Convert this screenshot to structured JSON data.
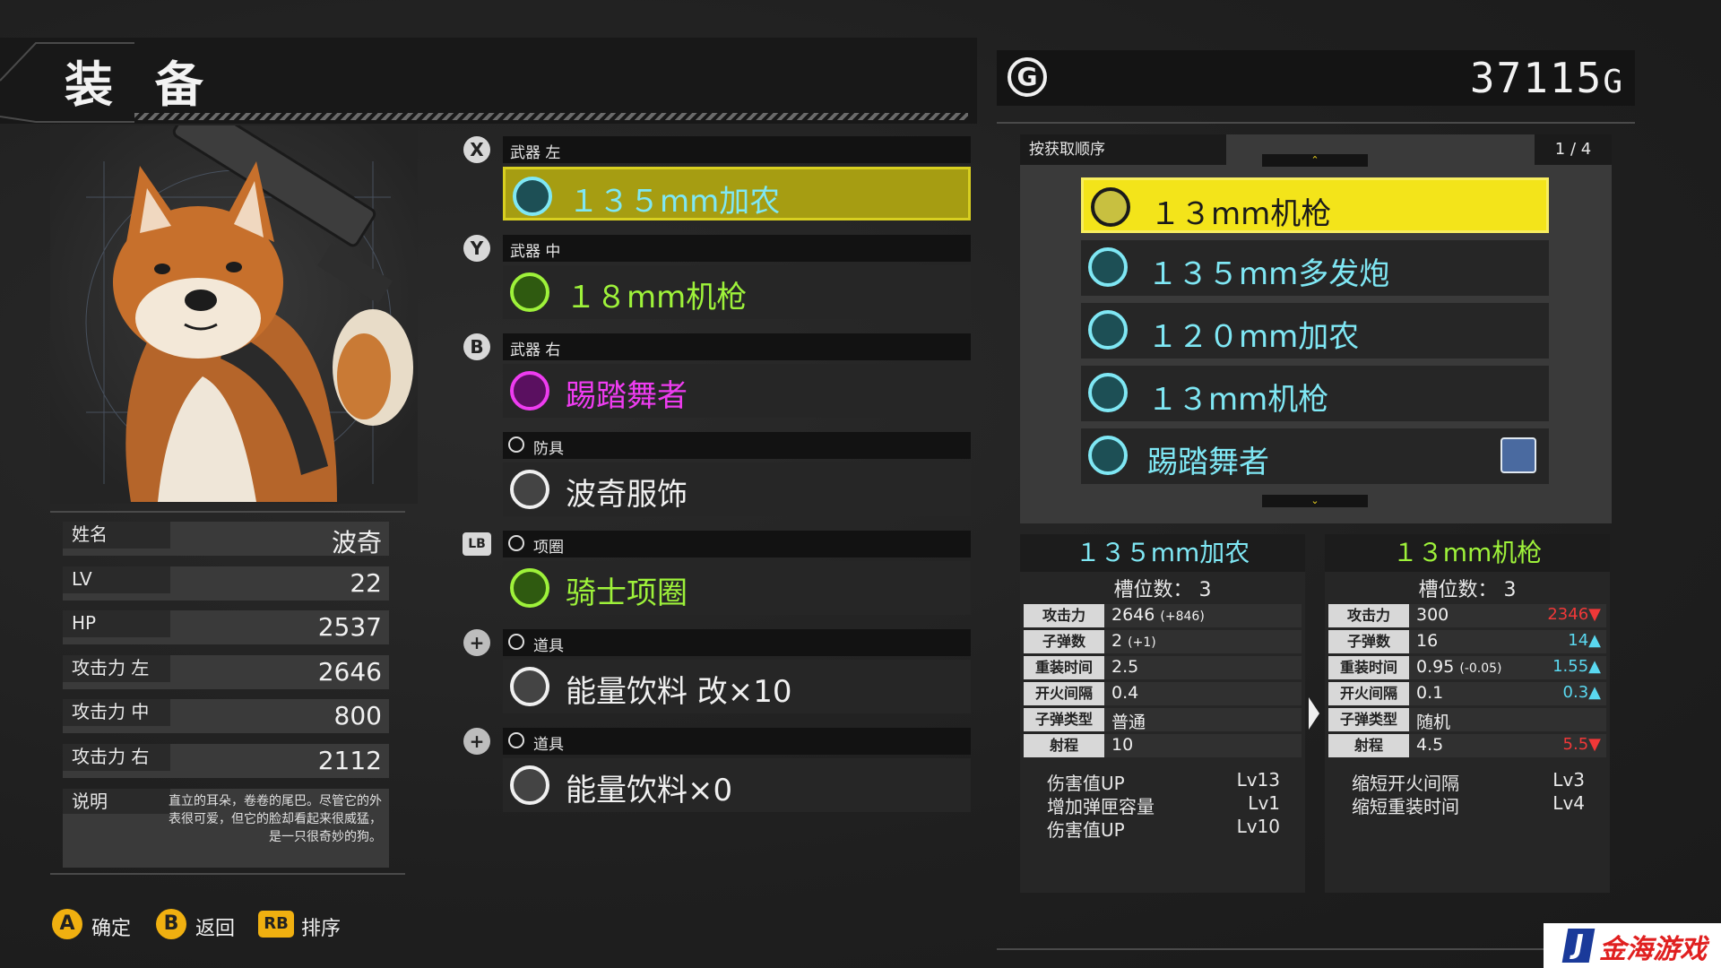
{
  "screen": {
    "title": "装 备",
    "gold_value": "37115",
    "gold_unit": "G",
    "gold_icon": "G"
  },
  "character": {
    "stats": [
      {
        "label": "姓名",
        "value": "波奇"
      },
      {
        "label": "LV",
        "value": "22"
      },
      {
        "label": "HP",
        "value": "2537"
      },
      {
        "label": "攻击力 左",
        "value": "2646"
      },
      {
        "label": "攻击力 中",
        "value": "800"
      },
      {
        "label": "攻击力 右",
        "value": "2112"
      }
    ],
    "description_label": "说明",
    "description": "直立的耳朵，卷卷的尾巴。尽管它的外表很可爱，但它的脸却看起来很威猛，是一只很奇妙的狗。"
  },
  "equipment": [
    {
      "button": "X",
      "slot": "武器 左",
      "name": "１３５mm加农",
      "color": "#7fe7f4",
      "icon": "cannon-icon",
      "selected": true
    },
    {
      "button": "Y",
      "slot": "武器 中",
      "name": "１８mm机枪",
      "color": "#9ef23a",
      "icon": "machine-gun-icon",
      "selected": false
    },
    {
      "button": "B",
      "slot": "武器 右",
      "name": "踢踏舞者",
      "color": "#ee3cf0",
      "icon": "dancer-icon",
      "selected": false
    },
    {
      "button": "",
      "slot": "防具",
      "name": "波奇服饰",
      "color": "#f0f0f0",
      "icon": "armor-icon",
      "selected": false
    },
    {
      "button": "LB",
      "slot": "项圈",
      "name": "骑士项圈",
      "color": "#9ef23a",
      "icon": "collar-icon",
      "selected": false
    },
    {
      "button": "+",
      "slot": "道具",
      "name": "能量饮料 改×10",
      "color": "#f0f0f0",
      "icon": "bag-icon",
      "selected": false
    },
    {
      "button": "+",
      "slot": "道具",
      "name": "能量饮料×0",
      "color": "#f0f0f0",
      "icon": "bag-icon",
      "selected": false
    }
  ],
  "list": {
    "sort_label": "按获取顺序",
    "page": "1 / 4",
    "scroll_up": "⌃",
    "scroll_down": "⌄",
    "items": [
      {
        "name": "１３mm机枪",
        "icon": "machine-gun-icon",
        "selected": true
      },
      {
        "name": "１３５mm多发炮",
        "icon": "cannon-icon",
        "selected": false
      },
      {
        "name": "１２０mm加农",
        "icon": "cannon-icon",
        "selected": false
      },
      {
        "name": "１３mm机枪",
        "icon": "machine-gun-icon",
        "selected": false
      },
      {
        "name": "踢踏舞者",
        "icon": "dancer-icon",
        "selected": false,
        "badge": "dog-badge-icon"
      }
    ]
  },
  "compare_left": {
    "title": "１３５mm加农",
    "slots": "槽位数： 3",
    "rows": [
      {
        "label": "攻击力",
        "value": "2646",
        "mod": "(+846)"
      },
      {
        "label": "子弹数",
        "value": "2",
        "mod": "(+1)"
      },
      {
        "label": "重装时间",
        "value": "2.5",
        "mod": ""
      },
      {
        "label": "开火间隔",
        "value": "0.4",
        "mod": ""
      },
      {
        "label": "子弹类型",
        "value": "普通",
        "mod": ""
      },
      {
        "label": "射程",
        "value": "10",
        "mod": ""
      }
    ],
    "skills": [
      {
        "name": "伤害值UP",
        "lv": "Lv13"
      },
      {
        "name": "增加弹匣容量",
        "lv": "Lv1"
      },
      {
        "name": "伤害值UP",
        "lv": "Lv10"
      }
    ]
  },
  "compare_right": {
    "title": "１３mm机枪",
    "slots": "槽位数： 3",
    "rows": [
      {
        "label": "攻击力",
        "value": "300",
        "mod": "",
        "diff": "2346",
        "dir": "down"
      },
      {
        "label": "子弹数",
        "value": "16",
        "mod": "",
        "diff": "14",
        "dir": "up"
      },
      {
        "label": "重装时间",
        "value": "0.95",
        "mod": "(-0.05)",
        "diff": "1.55",
        "dir": "up"
      },
      {
        "label": "开火间隔",
        "value": "0.1",
        "mod": "",
        "diff": "0.3",
        "dir": "up"
      },
      {
        "label": "子弹类型",
        "value": "随机",
        "mod": "",
        "diff": "",
        "dir": ""
      },
      {
        "label": "射程",
        "value": "4.5",
        "mod": "",
        "diff": "5.5",
        "dir": "down"
      }
    ],
    "skills": [
      {
        "name": "缩短开火间隔",
        "lv": "Lv3"
      },
      {
        "name": "缩短重装时间",
        "lv": "Lv4"
      }
    ]
  },
  "footer": {
    "hints": [
      {
        "button": "A",
        "label": "确定"
      },
      {
        "button": "B",
        "label": "返回"
      },
      {
        "button": "RB",
        "label": "排序"
      }
    ]
  },
  "watermark": {
    "logo": "J",
    "text": "金海游戏"
  },
  "colors": {
    "selected_yellow": "#f3e41a",
    "cyan": "#7fe7f4",
    "green": "#9ef23a",
    "magenta": "#ee3cf0",
    "up": "#5ad8f0",
    "down": "#f03838"
  }
}
